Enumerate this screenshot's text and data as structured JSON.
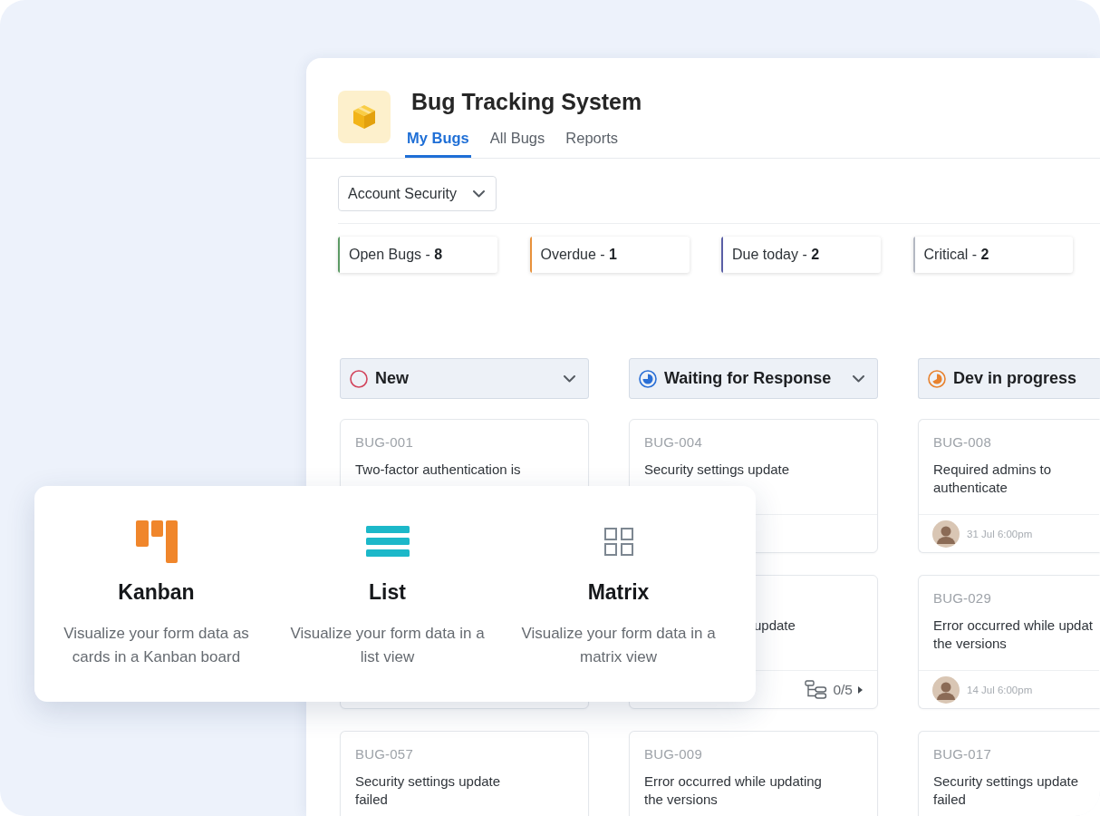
{
  "app": {
    "title": "Bug Tracking System"
  },
  "tabs": [
    {
      "label": "My Bugs",
      "selected": true
    },
    {
      "label": "All Bugs",
      "selected": false
    },
    {
      "label": "Reports",
      "selected": false
    }
  ],
  "project_filter": {
    "value": "Account Security"
  },
  "stats": [
    {
      "text": "Open Bugs - **8**",
      "color": "#5c9a64"
    },
    {
      "text": "Overdue - **1**",
      "color": "#e8913a"
    },
    {
      "text": "Due today - **2**",
      "color": "#5a5fa6"
    },
    {
      "text": "Critical - **2**",
      "color": "#b4b8c2"
    }
  ],
  "columns": [
    {
      "title": "New",
      "kind": "new",
      "color": "#d2445c",
      "caret": true,
      "cards": [
        {
          "kind": "full",
          "id": "BUG-001",
          "title": "Two-factor authentication is"
        },
        {
          "kind": "hidden"
        },
        {
          "kind": "full",
          "id": "BUG-057",
          "title": "Security settings update\nfailed"
        }
      ]
    },
    {
      "title": "Waiting for Response",
      "kind": "waiting",
      "color": "#2a6fd6",
      "caret": true,
      "cards": [
        {
          "kind": "full",
          "id": "BUG-004",
          "title": "Security settings update"
        },
        {
          "kind": "partial",
          "title": "update",
          "footer": {
            "subtasks": "0/5"
          }
        },
        {
          "kind": "full",
          "id": "BUG-009",
          "title": "Error occurred while updating\nthe versions"
        }
      ]
    },
    {
      "title": "Dev in progress",
      "kind": "progress",
      "color": "#e8822e",
      "caret": false,
      "cards": [
        {
          "kind": "full",
          "id": "BUG-008",
          "title": "Required admins to\nauthenticate",
          "footer": {
            "avatar": true,
            "date": "31 Jul 6:00pm"
          }
        },
        {
          "kind": "full",
          "id": "BUG-029",
          "title": "Error occurred while updat\nthe versions",
          "footer": {
            "avatar": true,
            "date": "14 Jul 6:00pm"
          }
        },
        {
          "kind": "full",
          "id": "BUG-017",
          "title": "Security settings update\nfailed"
        }
      ]
    }
  ],
  "view_picker": [
    {
      "kind": "kanban",
      "title": "Kanban",
      "description": "Visualize your form data as\ncards in a Kanban board"
    },
    {
      "kind": "list",
      "title": "List",
      "description": "Visualize your form data in a\nlist view"
    },
    {
      "kind": "matrix",
      "title": "Matrix",
      "description": "Visualize your form data in a\nmatrix view"
    }
  ]
}
